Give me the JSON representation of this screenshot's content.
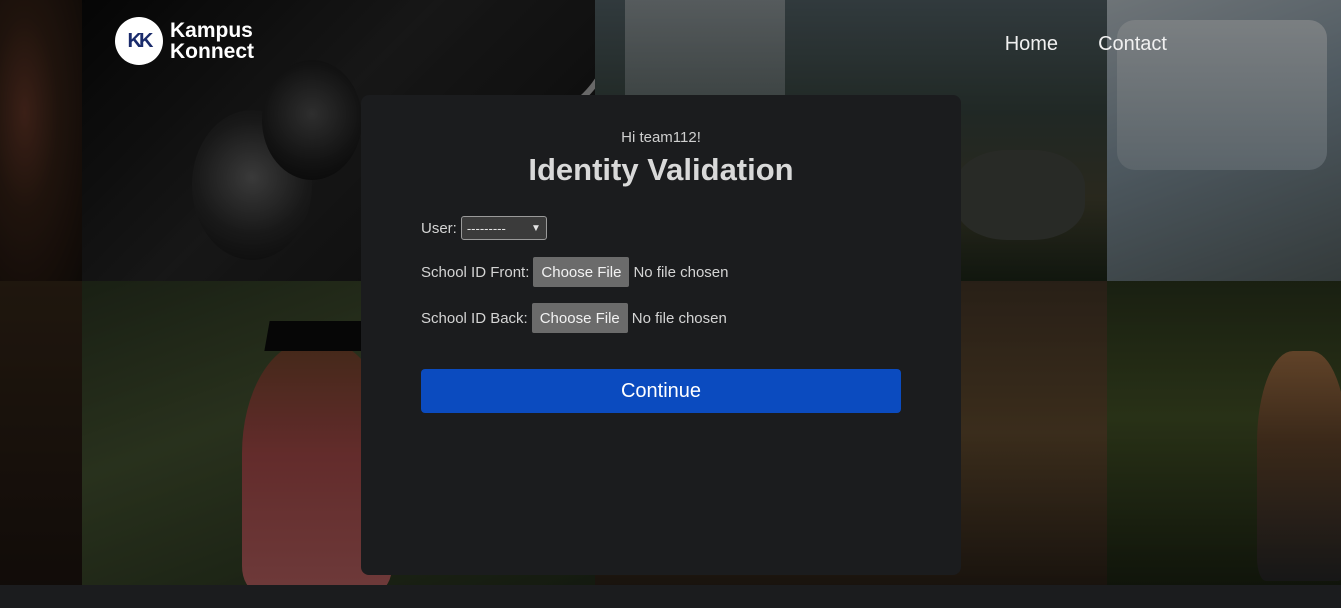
{
  "brand": {
    "logo_initials": "KK",
    "line1": "Kampus",
    "line2": "Konnect"
  },
  "nav": {
    "home": "Home",
    "contact": "Contact"
  },
  "card": {
    "greeting": "Hi team112!",
    "title": "Identity Validation",
    "user_label": "User:",
    "user_selected": "---------",
    "front_label": "School ID Front:",
    "back_label": "School ID Back:",
    "choose_file": "Choose File",
    "no_file": "No file chosen",
    "continue": "Continue"
  },
  "colors": {
    "primary": "#0b4bbf",
    "card_bg": "#1b1c1e",
    "logo_text": "#1a2b6b"
  }
}
